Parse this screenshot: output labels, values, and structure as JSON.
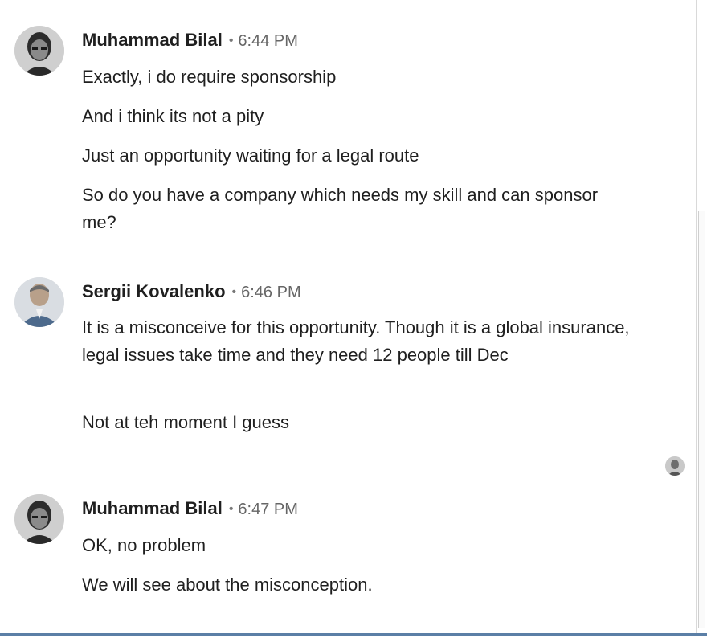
{
  "conversation": {
    "groups": [
      {
        "sender": "Muhammad Bilal",
        "separator": "•",
        "time": "6:44 PM",
        "avatar_icon": "person-dark-icon",
        "messages": [
          "Exactly, i do require sponsorship",
          "And i think its not a pity",
          "Just an opportunity waiting for a legal route",
          "So do you have a company which needs my skill and can sponsor me?"
        ]
      },
      {
        "sender": "Sergii Kovalenko",
        "separator": "•",
        "time": "6:46 PM",
        "avatar_icon": "person-light-icon",
        "messages": [
          "It is a misconceive for this opportunity. Though it is a global insurance, legal issues take time and they need 12 people till Dec",
          "Not at teh moment I guess"
        ]
      },
      {
        "sender": "Muhammad Bilal",
        "separator": "•",
        "time": "6:47 PM",
        "avatar_icon": "person-dark-icon",
        "messages": [
          "OK, no problem",
          "We will see about the misconception."
        ]
      }
    ],
    "seen_receipt_icon": "seen-avatar-icon"
  },
  "colors": {
    "text": "#1f1f1f",
    "meta": "#666666",
    "accent_rule": "#5b7fa6"
  }
}
